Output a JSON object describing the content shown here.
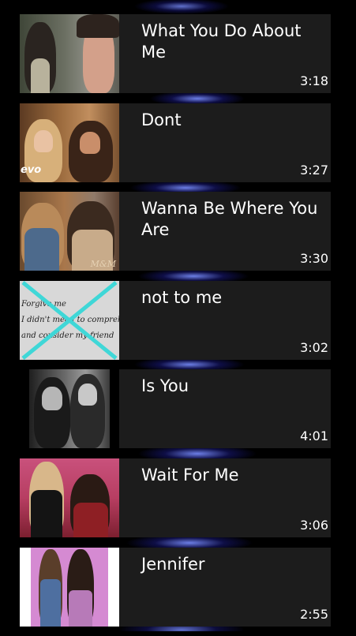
{
  "videos": [
    {
      "title": "What You Do About Me",
      "duration": "3:18"
    },
    {
      "title": "Dont",
      "duration": "3:27"
    },
    {
      "title": "Wanna Be Where You Are",
      "duration": "3:30"
    },
    {
      "title": "not to me",
      "duration": "3:02"
    },
    {
      "title": "Is You",
      "duration": "4:01"
    },
    {
      "title": "Wait For Me",
      "duration": "3:06"
    },
    {
      "title": "Jennifer",
      "duration": "2:55"
    }
  ],
  "thumbnails": {
    "vevo_watermark": "evo",
    "lyrics_lines": [
      "Forgive me",
      "I didn't mean to comprehe",
      "and consider my friend"
    ],
    "corner_mark": "M&M"
  },
  "colors": {
    "card_background": "#1c1c1c",
    "text": "#ffffff",
    "background_glow": "#5a6cff",
    "strike_mark": "#3fd7d7"
  }
}
